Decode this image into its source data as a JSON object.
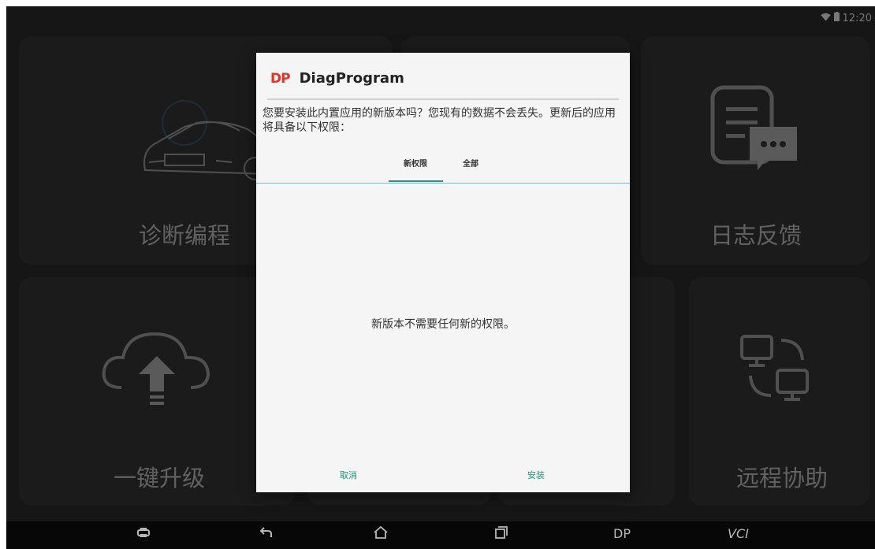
{
  "status_bar": {
    "time": "12:20",
    "wifi_icon": "wifi-icon",
    "battery_icon": "battery-icon"
  },
  "tiles": {
    "diagnose": {
      "label": "诊断编程",
      "icon": "car-icon"
    },
    "log_feedback": {
      "label": "日志反馈",
      "icon": "document-chat-icon"
    },
    "one_click_upgrade": {
      "label": "一键升级",
      "icon": "cloud-upload-icon"
    },
    "remote_assist": {
      "label": "远程协助",
      "icon": "remote-computers-icon"
    }
  },
  "dialog": {
    "logo": "DP",
    "app_name": "DiagProgram",
    "message": "您要安装此内置应用的新版本吗？您现有的数据不会丢失。更新后的应用将具备以下权限：",
    "tabs": [
      "新权限",
      "全部"
    ],
    "selected_tab": "新权限",
    "body_text": "新版本不需要任何新的权限。",
    "cancel_label": "取消",
    "install_label": "安装"
  },
  "navbar": {
    "dp_label": "DP",
    "vci_label": "VCI"
  },
  "colors": {
    "accent": "#1a9a7a",
    "logo": "#e1352b",
    "background": "#262626"
  }
}
